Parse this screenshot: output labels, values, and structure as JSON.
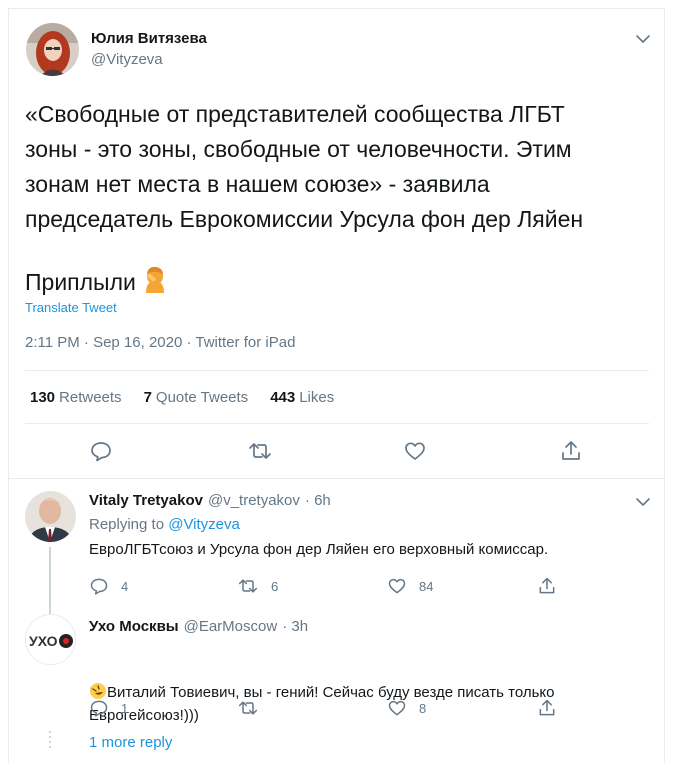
{
  "main_tweet": {
    "author_name": "Юлия Витязева",
    "author_handle": "@Vityzeva",
    "text": "«Свободные от представителей сообщества ЛГБТ\nзоны - это зоны, свободные от человечности. Этим\nзонам нет места в нашем союзе» - заявила\nпредседатель Еврокомиссии Урсула фон дер Ляйен",
    "text2": "Приплыли",
    "emoji_icon": "person-facepalming-emoji",
    "translate_label": "Translate Tweet",
    "meta": "2:11 PM · Sep 16, 2020 · Twitter for iPad",
    "stats": {
      "retweets_count": "130",
      "retweets_label": "Retweets",
      "quotes_count": "7",
      "quotes_label": "Quote Tweets",
      "likes_count": "443",
      "likes_label": "Likes"
    }
  },
  "replies": [
    {
      "name": "Vitaly Tretyakov",
      "handle": "@v_tretyakov",
      "time": "· 6h",
      "replying_prefix": "Replying to",
      "replying_to": "@Vityzeva",
      "text": "ЕвроЛГБТсоюз и Урсула фон дер Ляйен  его верховный комиссар.",
      "reply_count": "4",
      "retweet_count": "6",
      "like_count": "84"
    },
    {
      "name": "Ухо Москвы",
      "handle": "@EarMoscow",
      "time": "· 3h",
      "avatar_text": "УХО",
      "text": "Виталий Товиевич, вы - гений! Сейчас буду везде писать только\nЕврогейсоюз!)))",
      "emoji_icon": "rolling-on-floor-laughing-emoji",
      "reply_count": "1",
      "retweet_count": "",
      "like_count": "8"
    }
  ],
  "more_replies_label": "1 more reply",
  "colors": {
    "link": "#1b95e0",
    "secondary_text": "#657786",
    "border": "#e6ecf0"
  }
}
